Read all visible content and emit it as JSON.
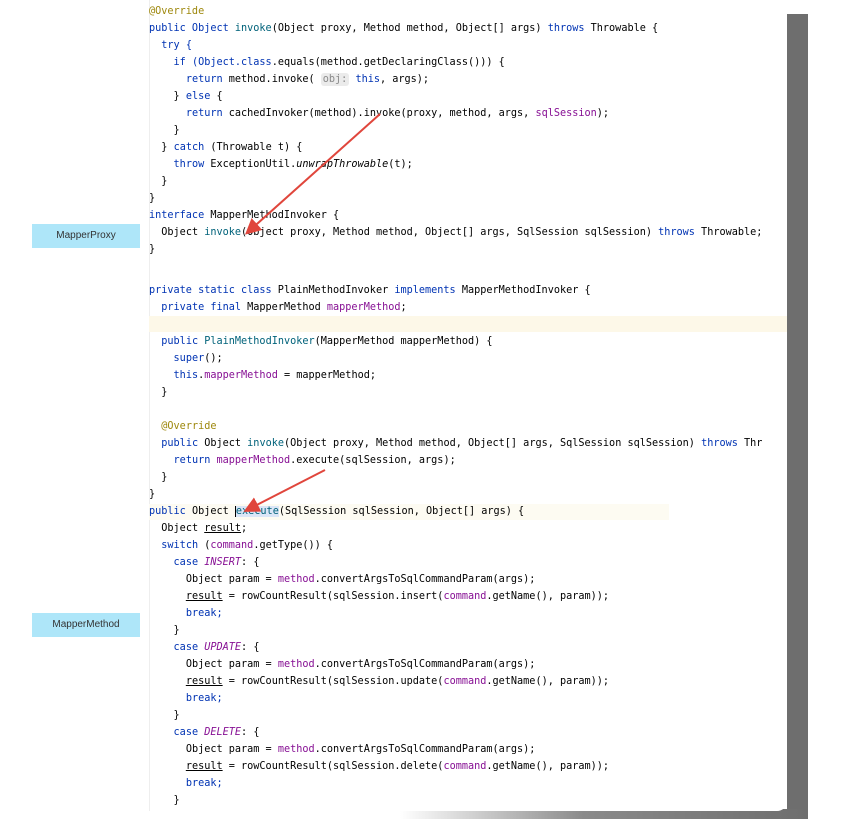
{
  "labels": {
    "mapper_proxy": "MapperProxy",
    "mapper_method": "MapperMethod"
  },
  "colors": {
    "keyword": "#0033b3",
    "annotation": "#9e880d",
    "method": "#00627a",
    "field": "#871094",
    "label_bg": "#aee6f9",
    "arrow": "#e0463c",
    "inlay_hint_bg": "#ebebeb"
  },
  "code": {
    "l1": "@Override",
    "l2_a": "public Object ",
    "l2_b": "invoke",
    "l2_c": "(Object proxy, Method method, Object[] args) ",
    "l2_d": "throws",
    "l2_e": " Throwable {",
    "l3": "try {",
    "l4_a": "if (Object.",
    "l4_b": "class",
    "l4_c": ".equals(method.getDeclaringClass())) {",
    "l5_a": "return",
    "l5_b": " method.invoke( ",
    "l5_hint": "obj:",
    "l5_c": " ",
    "l5_d": "this",
    "l5_e": ", args);",
    "l6_a": "} ",
    "l6_b": "else",
    "l6_c": " {",
    "l7_a": "return",
    "l7_b": " cachedInvoker(method).invoke(proxy, method, args, ",
    "l7_c": "sqlSession",
    "l7_d": ");",
    "l8": "}",
    "l9_a": "} ",
    "l9_b": "catch",
    "l9_c": " (Throwable t) {",
    "l10_a": "throw",
    "l10_b": " ExceptionUtil.",
    "l10_c": "unwrapThrowable",
    "l10_d": "(t);",
    "l11": "}",
    "l12": "}",
    "l13_a": "interface",
    "l13_b": " MapperMethodInvoker {",
    "l14_a": "Object ",
    "l14_b": "invoke",
    "l14_c": "(Object proxy, Method method, Object[] args, SqlSession sqlSession) ",
    "l14_d": "throws",
    "l14_e": " Throwable;",
    "l15": "}",
    "l17_a": "private static class",
    "l17_b": " PlainMethodInvoker ",
    "l17_c": "implements",
    "l17_d": " MapperMethodInvoker {",
    "l18_a": "private final",
    "l18_b": " MapperMethod ",
    "l18_c": "mapperMethod",
    "l18_d": ";",
    "l20_a": "public",
    "l20_b": " ",
    "l20_c": "PlainMethodInvoker",
    "l20_d": "(MapperMethod mapperMethod) {",
    "l21_a": "super",
    "l21_b": "();",
    "l22_a": "this",
    "l22_b": ".",
    "l22_c": "mapperMethod",
    "l22_d": " = mapperMethod;",
    "l23": "}",
    "l25": "@Override",
    "l26_a": "public",
    "l26_b": " Object ",
    "l26_c": "invoke",
    "l26_d": "(Object proxy, Method method, Object[] args, SqlSession sqlSession) ",
    "l26_e": "throws",
    "l26_f": " Thr",
    "l27_a": "return",
    "l27_b": " ",
    "l27_c": "mapperMethod",
    "l27_d": ".execute(sqlSession, args);",
    "l28": "}",
    "l29": "}",
    "l30_a": "public",
    "l30_b": " Object ",
    "l30_c": "execute",
    "l30_d": "(SqlSession sqlSession, Object[] args) {",
    "l31_a": "Object ",
    "l31_b": "result",
    "l31_c": ";",
    "l32_a": "switch",
    "l32_b": " (",
    "l32_c": "command",
    "l32_d": ".getType()) {",
    "l33_a": "case",
    "l33_b": " ",
    "l33_c": "INSERT",
    "l33_d": ": {",
    "l34_a": "Object param = ",
    "l34_b": "method",
    "l34_c": ".convertArgsToSqlCommandParam(args);",
    "l35_a": "result",
    "l35_b": " = rowCountResult(sqlSession.insert(",
    "l35_c": "command",
    "l35_d": ".getName(), param));",
    "l36": "break;",
    "l37": "}",
    "l38_a": "case",
    "l38_b": " ",
    "l38_c": "UPDATE",
    "l38_d": ": {",
    "l39_a": "Object param = ",
    "l39_b": "method",
    "l39_c": ".convertArgsToSqlCommandParam(args);",
    "l40_a": "result",
    "l40_b": " = rowCountResult(sqlSession.update(",
    "l40_c": "command",
    "l40_d": ".getName(), param));",
    "l41": "break;",
    "l42": "}",
    "l43_a": "case",
    "l43_b": " ",
    "l43_c": "DELETE",
    "l43_d": ": {",
    "l44_a": "Object param = ",
    "l44_b": "method",
    "l44_c": ".convertArgsToSqlCommandParam(args);",
    "l45_a": "result",
    "l45_b": " = rowCountResult(sqlSession.delete(",
    "l45_c": "command",
    "l45_d": ".getName(), param));",
    "l46": "break;",
    "l47": "}"
  }
}
